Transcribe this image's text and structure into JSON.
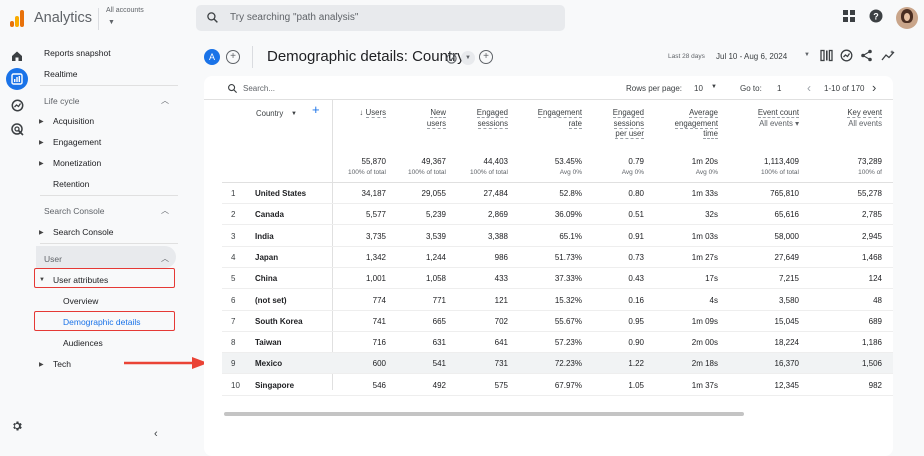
{
  "app": {
    "title": "Analytics",
    "account_label": "All accounts",
    "search_placeholder": "Try searching \"path analysis\""
  },
  "sidebar": {
    "top_items": [
      "Reports snapshot",
      "Realtime"
    ],
    "lifecycle": {
      "label": "Life cycle",
      "items": [
        "Acquisition",
        "Engagement",
        "Monetization",
        "Retention"
      ]
    },
    "search_console": {
      "label": "Search Console",
      "items": [
        "Search Console"
      ]
    },
    "user": {
      "label": "User",
      "group_label": "User attributes",
      "sub_items": [
        "Overview",
        "Demographic details",
        "Audiences"
      ],
      "tech_label": "Tech"
    },
    "highlight_color": "#e53935"
  },
  "header": {
    "avatar_letter": "A",
    "page_title": "Demographic details: Country",
    "date_small": "Last 28 days",
    "date_range": "Jul 10 - Aug 6, 2024"
  },
  "table": {
    "search_placeholder": "Search...",
    "rows_per_page_label": "Rows per page:",
    "rows_per_page_value": "10",
    "goto_label": "Go to:",
    "goto_value": "1",
    "pagination": "1-10 of 170",
    "dimension_label": "Country",
    "columns": [
      {
        "lines": [
          "Users"
        ],
        "sort": "↓"
      },
      {
        "lines": [
          "New",
          "users"
        ]
      },
      {
        "lines": [
          "Engaged",
          "sessions"
        ]
      },
      {
        "lines": [
          "Engagement",
          "rate"
        ]
      },
      {
        "lines": [
          "Engaged",
          "sessions",
          "per user"
        ]
      },
      {
        "lines": [
          "Average",
          "engagement",
          "time"
        ]
      },
      {
        "lines": [
          "Event count"
        ],
        "sub": "All events"
      },
      {
        "lines": [
          "Key event"
        ],
        "sub": "All events"
      }
    ],
    "totals": [
      "55,870",
      "49,367",
      "44,403",
      "53.45%",
      "0.79",
      "1m 20s",
      "1,113,409",
      "73,289"
    ],
    "totals_sub": [
      "100% of total",
      "100% of total",
      "100% of total",
      "Avg 0%",
      "Avg 0%",
      "Avg 0%",
      "100% of total",
      "100% of"
    ],
    "rows": [
      {
        "idx": "1",
        "country": "United States",
        "values": [
          "34,187",
          "29,055",
          "27,484",
          "52.8%",
          "0.80",
          "1m 33s",
          "765,810",
          "55,278"
        ]
      },
      {
        "idx": "2",
        "country": "Canada",
        "values": [
          "5,577",
          "5,239",
          "2,869",
          "36.09%",
          "0.51",
          "32s",
          "65,616",
          "2,785"
        ]
      },
      {
        "idx": "3",
        "country": "India",
        "values": [
          "3,735",
          "3,539",
          "3,388",
          "65.1%",
          "0.91",
          "1m 03s",
          "58,000",
          "2,945"
        ]
      },
      {
        "idx": "4",
        "country": "Japan",
        "values": [
          "1,342",
          "1,244",
          "986",
          "51.73%",
          "0.73",
          "1m 27s",
          "27,649",
          "1,468"
        ]
      },
      {
        "idx": "5",
        "country": "China",
        "values": [
          "1,001",
          "1,058",
          "433",
          "37.33%",
          "0.43",
          "17s",
          "7,215",
          "124"
        ]
      },
      {
        "idx": "6",
        "country": "(not set)",
        "values": [
          "774",
          "771",
          "121",
          "15.32%",
          "0.16",
          "4s",
          "3,580",
          "48"
        ]
      },
      {
        "idx": "7",
        "country": "South Korea",
        "values": [
          "741",
          "665",
          "702",
          "55.67%",
          "0.95",
          "1m 09s",
          "15,045",
          "689"
        ]
      },
      {
        "idx": "8",
        "country": "Taiwan",
        "values": [
          "716",
          "631",
          "641",
          "57.23%",
          "0.90",
          "2m 00s",
          "18,224",
          "1,186"
        ]
      },
      {
        "idx": "9",
        "country": "Mexico",
        "values": [
          "600",
          "541",
          "731",
          "72.23%",
          "1.22",
          "2m 18s",
          "16,370",
          "1,506"
        ]
      },
      {
        "idx": "10",
        "country": "Singapore",
        "values": [
          "546",
          "492",
          "575",
          "67.97%",
          "1.05",
          "1m 37s",
          "12,345",
          "982"
        ]
      }
    ]
  },
  "colors": {
    "accent": "#1a73e8",
    "annotation_red": "#e53935"
  }
}
